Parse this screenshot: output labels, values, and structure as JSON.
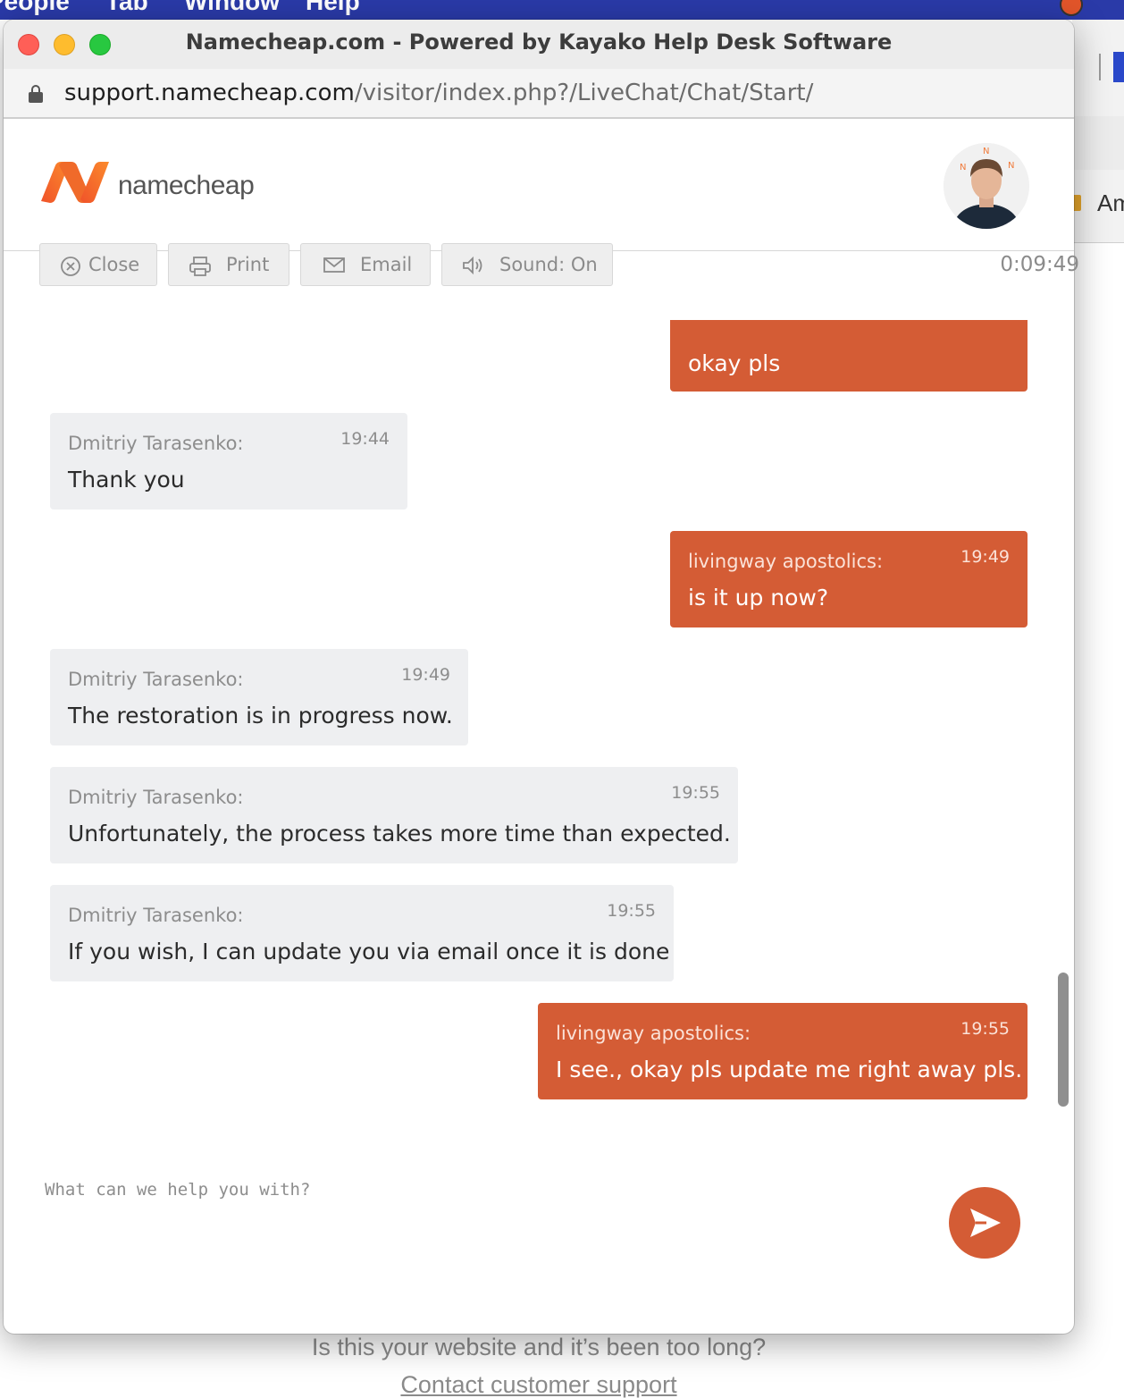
{
  "mac_menubar": {
    "items": [
      "People",
      "Tab",
      "Window",
      "Help"
    ]
  },
  "background_page": {
    "bookmark_label": "Am",
    "footer_question": "Is this your website and it’s been too long?",
    "footer_link": "Contact customer support"
  },
  "window": {
    "title": "Namecheap.com - Powered by Kayako Help Desk Software",
    "url_host": "support.namecheap.com",
    "url_path": "/visitor/index.php?/LiveChat/Chat/Start/"
  },
  "header": {
    "logo_text": "namecheap",
    "logo_icon": "namecheap-n-logo",
    "avatar_icon": "agent-avatar"
  },
  "toolbar": {
    "close_label": "Close",
    "close_icon": "circle-x-icon",
    "print_label": "Print",
    "print_icon": "printer-icon",
    "email_label": "Email",
    "email_icon": "envelope-icon",
    "sound_label": "Sound: On",
    "sound_icon": "speaker-icon",
    "timer": "0:09:49"
  },
  "messages": [
    {
      "role": "user",
      "sender": "",
      "time": "",
      "text": "okay pls"
    },
    {
      "role": "agent",
      "sender": "Dmitriy Tarasenko:",
      "time": "19:44",
      "text": "Thank you"
    },
    {
      "role": "user",
      "sender": "livingway apostolics:",
      "time": "19:49",
      "text": "is it up now?"
    },
    {
      "role": "agent",
      "sender": "Dmitriy Tarasenko:",
      "time": "19:49",
      "text": "The restoration is in progress now."
    },
    {
      "role": "agent",
      "sender": "Dmitriy Tarasenko:",
      "time": "19:55",
      "text": "Unfortunately, the process takes more time than expected."
    },
    {
      "role": "agent",
      "sender": "Dmitriy Tarasenko:",
      "time": "19:55",
      "text": "If you wish, I can update you via email once it is done"
    },
    {
      "role": "user",
      "sender": "livingway apostolics:",
      "time": "19:55",
      "text": "I see., okay pls update me right away pls."
    }
  ],
  "input": {
    "placeholder": "What can we help you with?",
    "value": ""
  },
  "colors": {
    "accent": "#d45c35",
    "agent_bubble": "#eeeff1",
    "toolbar_button": "#eeeeee"
  },
  "send_icon": "paper-plane-icon"
}
